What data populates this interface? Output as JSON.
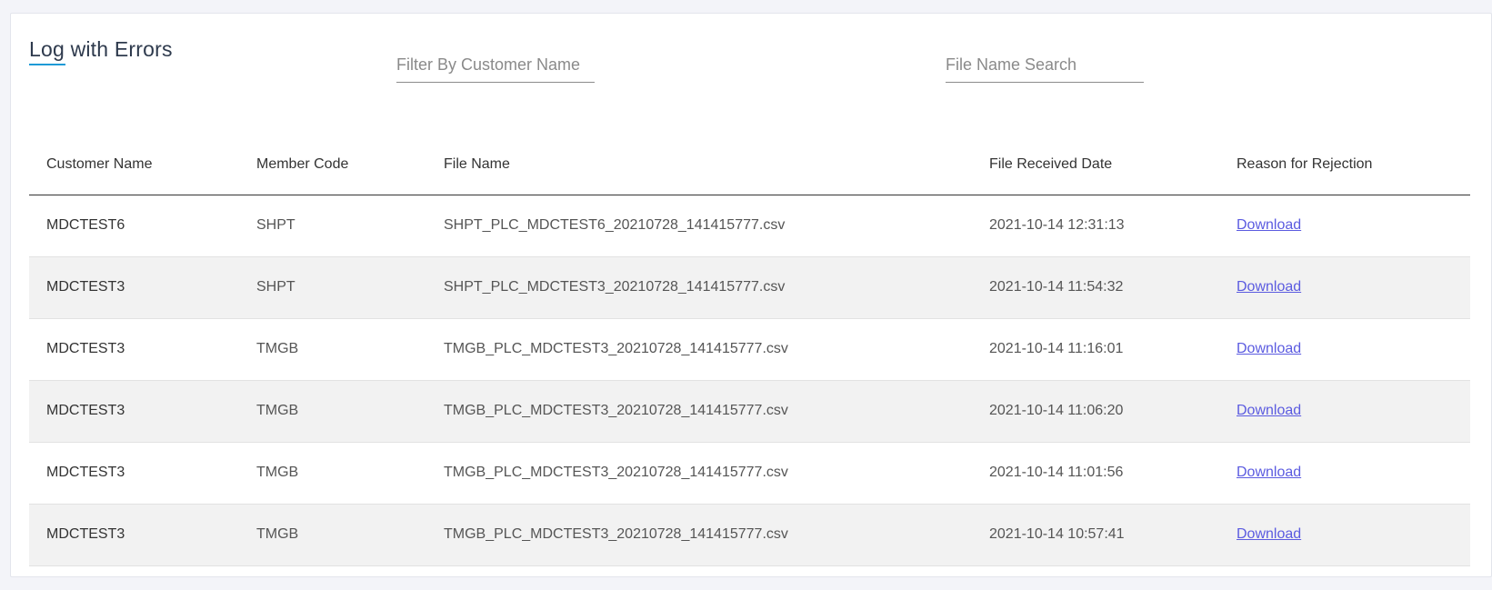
{
  "page": {
    "title": "Log with Errors",
    "accent_color": "#1e9ad6",
    "link_color": "#5b5be0"
  },
  "filters": {
    "customer_placeholder": "Filter By Customer Name",
    "customer_value": "",
    "file_placeholder": "File Name Search",
    "file_value": ""
  },
  "table": {
    "headers": {
      "customer": "Customer Name",
      "member": "Member Code",
      "file": "File Name",
      "date": "File Received Date",
      "reason": "Reason for Rejection"
    },
    "rows": [
      {
        "customer": "MDCTEST6",
        "member": "SHPT",
        "file": "SHPT_PLC_MDCTEST6_20210728_141415777.csv",
        "date": "2021-10-14 12:31:13",
        "reason": "Download"
      },
      {
        "customer": "MDCTEST3",
        "member": "SHPT",
        "file": "SHPT_PLC_MDCTEST3_20210728_141415777.csv",
        "date": "2021-10-14 11:54:32",
        "reason": "Download"
      },
      {
        "customer": "MDCTEST3",
        "member": "TMGB",
        "file": "TMGB_PLC_MDCTEST3_20210728_141415777.csv",
        "date": "2021-10-14 11:16:01",
        "reason": "Download"
      },
      {
        "customer": "MDCTEST3",
        "member": "TMGB",
        "file": "TMGB_PLC_MDCTEST3_20210728_141415777.csv",
        "date": "2021-10-14 11:06:20",
        "reason": "Download"
      },
      {
        "customer": "MDCTEST3",
        "member": "TMGB",
        "file": "TMGB_PLC_MDCTEST3_20210728_141415777.csv",
        "date": "2021-10-14 11:01:56",
        "reason": "Download"
      },
      {
        "customer": "MDCTEST3",
        "member": "TMGB",
        "file": "TMGB_PLC_MDCTEST3_20210728_141415777.csv",
        "date": "2021-10-14 10:57:41",
        "reason": "Download"
      }
    ]
  }
}
